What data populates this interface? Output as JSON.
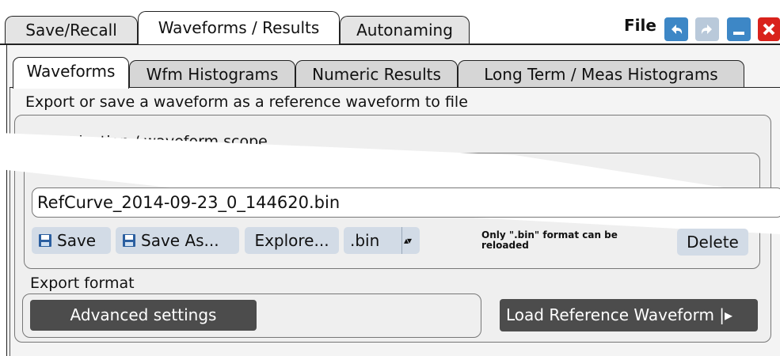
{
  "top_tabs": {
    "save_recall": "Save/Recall",
    "waveforms_results": "Waveforms / Results",
    "autonaming": "Autonaming"
  },
  "toolbar": {
    "file_label": "File",
    "icons": [
      "undo-icon",
      "redo-icon",
      "minimize-icon",
      "close-icon"
    ]
  },
  "sub_tabs": {
    "waveforms": "Waveforms",
    "wfm_histograms": "Wfm Histograms",
    "numeric_results": "Numeric Results",
    "long_term": "Long Term / Meas Histograms"
  },
  "main": {
    "description": "Export or save a waveform as a reference waveform to file",
    "scope_label": "…lt selection / waveform scope",
    "file_name": "RefCurve_2014-09-23_0_144620.bin",
    "buttons": {
      "save": "Save",
      "save_as": "Save As...",
      "explore": "Explore...",
      "format": ".bin",
      "format_arrows": "▴▾",
      "delete": "Delete"
    },
    "note": "Only \".bin\" format can be reloaded",
    "export_format_label": "Export format",
    "advanced_settings": "Advanced settings",
    "load_reference": "Load Reference Waveform |▸"
  },
  "colors": {
    "button_blue": "#d2dbe6",
    "dark_button": "#4c4c4c",
    "toolbar_blue": "#3d87c6",
    "close_red": "#d9221c"
  }
}
